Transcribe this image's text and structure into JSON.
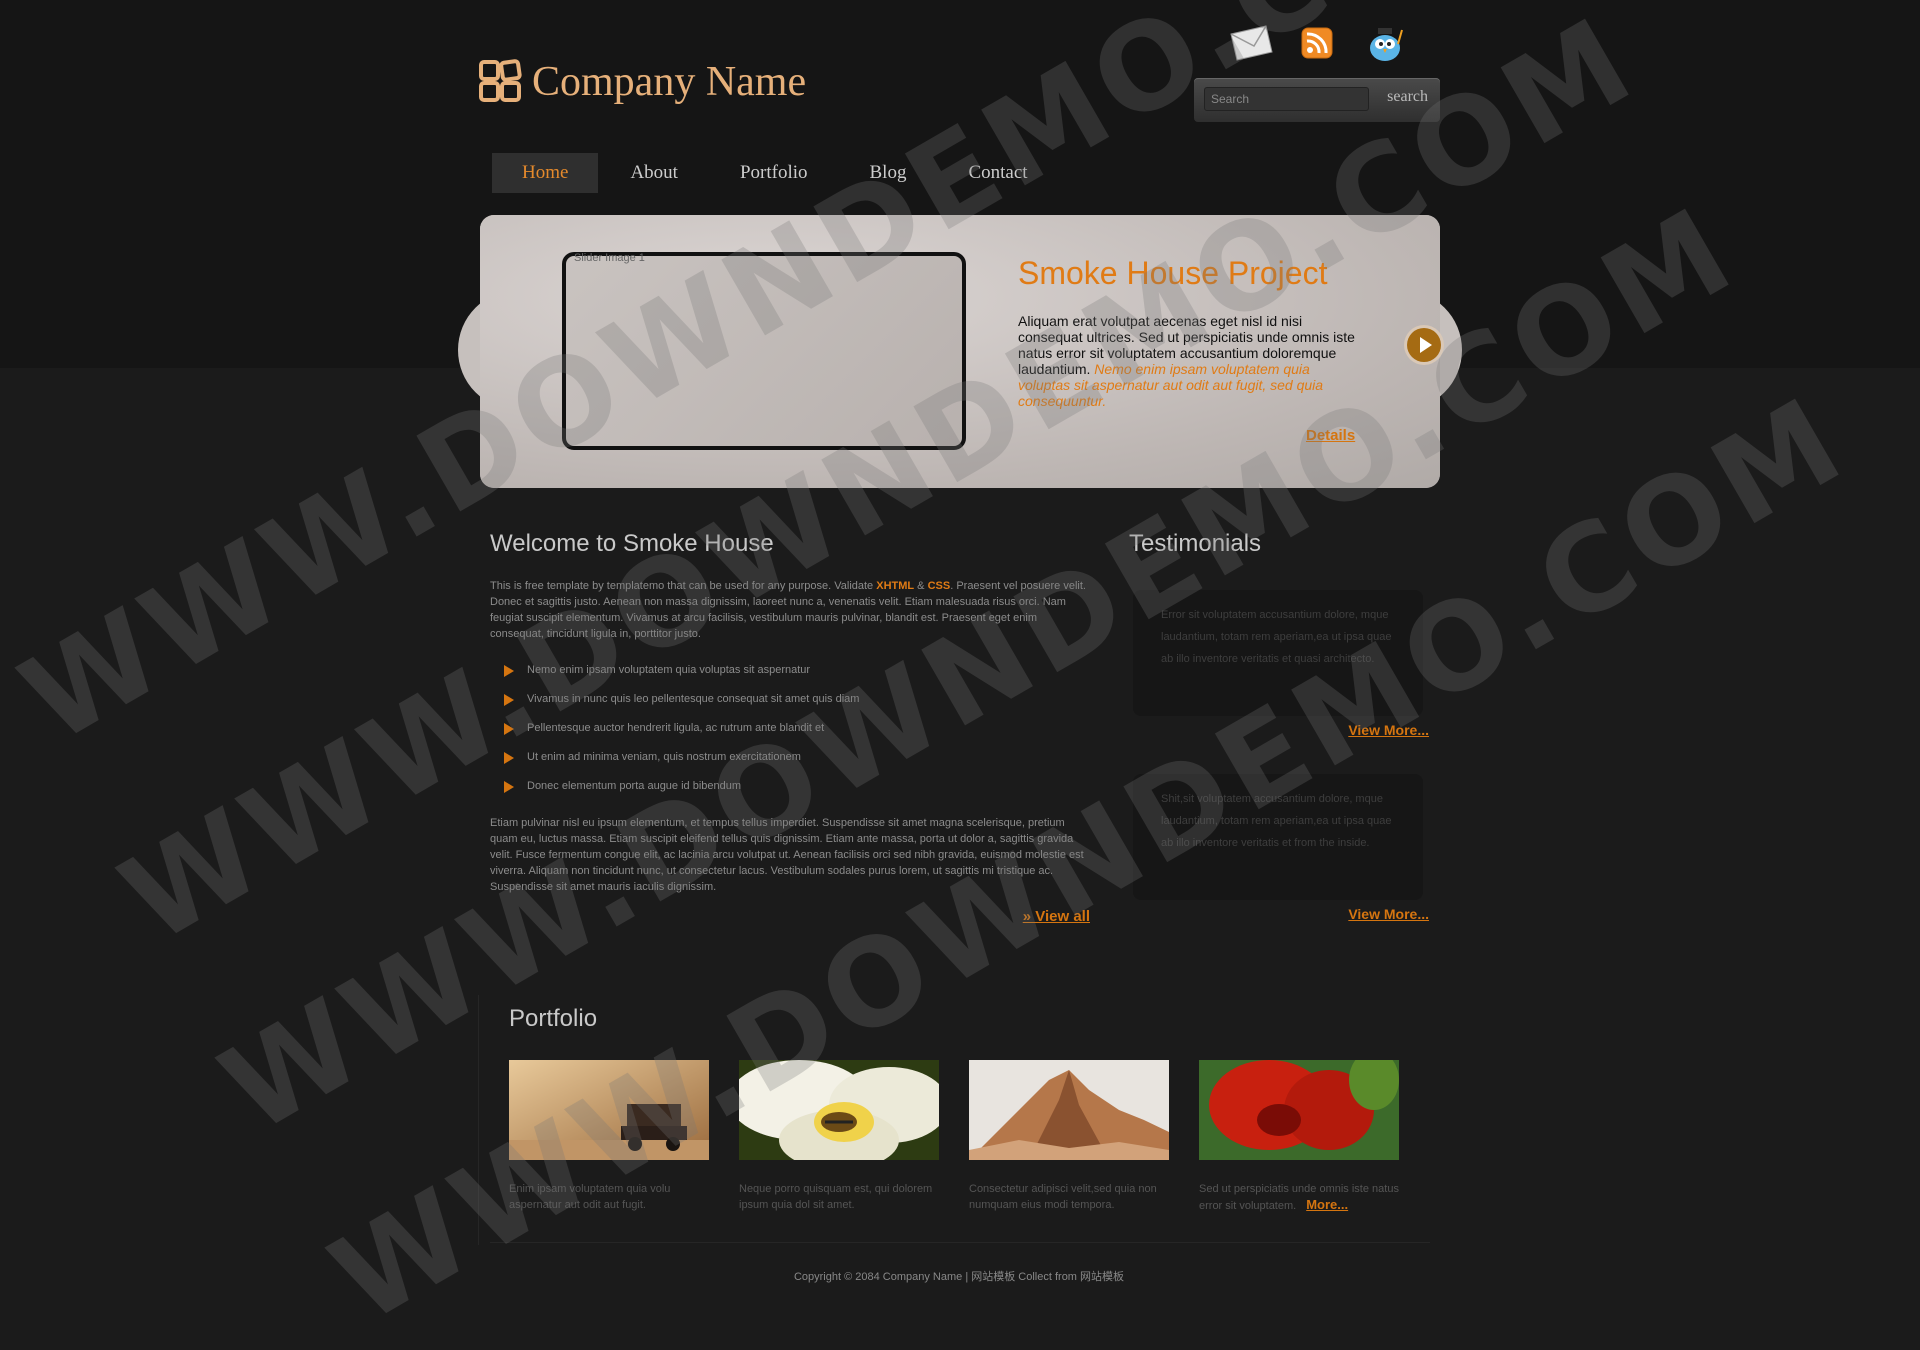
{
  "header": {
    "company_name": "Company Name",
    "social_icons": [
      "mail-icon",
      "rss-icon",
      "twitter-bird-icon"
    ],
    "search": {
      "placeholder": "Search",
      "button_label": "search"
    }
  },
  "nav": {
    "items": [
      {
        "label": "Home",
        "active": true
      },
      {
        "label": "About",
        "active": false
      },
      {
        "label": "Portfolio",
        "active": false
      },
      {
        "label": "Blog",
        "active": false
      },
      {
        "label": "Contact",
        "active": false
      }
    ]
  },
  "slider": {
    "image_alt": "Slider Image 1",
    "title": "Smoke House Project",
    "description": "Aliquam erat volutpat aecenas eget nisl id nisi consequat ultrices. Sed ut perspiciatis unde omnis iste natus error sit voluptatem accusantium doloremque laudantium.",
    "description_em": "Nemo enim ipsam voluptatem quia voluptas sit aspernatur aut odit aut fugit, sed quia consequuntur.",
    "details_label": "Details"
  },
  "welcome": {
    "title": "Welcome to Smoke House",
    "intro_1": "This is free template by templatemo that can be used for any purpose. Validate ",
    "xhtml": "XHTML",
    "amp": " & ",
    "css": "CSS",
    "intro_2": ". Praesent vel posuere velit. Donec et sagittis justo. Aenean non massa dignissim, laoreet nunc a, venenatis velit. Etiam malesuada risus orci. Nam feugiat suscipit elementum. Vivamus at arcu facilisis, vestibulum mauris pulvinar, blandit est. Praesent eget enim consequat, tincidunt ligula in, porttitor justo.",
    "bullets": [
      "Nemo enim ipsam voluptatem quia voluptas sit aspernatur",
      "Vivamus in nunc quis leo pellentesque consequat sit amet quis diam",
      "Pellentesque auctor hendrerit ligula, ac rutrum ante blandit et",
      "Ut enim ad minima veniam, quis nostrum exercitationem",
      "Donec elementum porta augue id bibendum"
    ],
    "outro": "Etiam pulvinar nisl eu ipsum elementum, et tempus tellus imperdiet. Suspendisse sit amet magna scelerisque, pretium quam eu, luctus massa. Etiam suscipit eleifend tellus quis dignissim. Etiam ante massa, porta ut dolor a, sagittis gravida velit. Fusce fermentum congue elit, ac lacinia arcu volutpat ut. Aenean facilisis orci sed nibh gravida, euismod molestie est viverra. Aliquam non tincidunt nunc, ut consectetur lacus. Vestibulum sodales purus lorem, ut sagittis mi tristique ac. Suspendisse sit amet mauris iaculis dignissim.",
    "view_all": "» View all"
  },
  "testimonials": {
    "title": "Testimonials",
    "items": [
      {
        "text": "Error sit voluptatem accusantium dolore, mque laudantium, totam rem aperiam,ea ut ipsa quae ab illo inventore veritatis et quasi architecto.",
        "more": "View More..."
      },
      {
        "text": "Shit,sit voluptatem accusantium dolore, mque laudantium, totam rem aperiam,ea ut ipsa quae ab illo inventore veritatis et from the inside.",
        "more": "View More..."
      }
    ]
  },
  "portfolio": {
    "title": "Portfolio",
    "items": [
      {
        "image": "truck-desert-image",
        "caption": "Enim ipsam voluptatem quia volu aspernatur aut odit aut fugit."
      },
      {
        "image": "bee-flower-image",
        "caption": "Neque porro quisquam est, qui dolorem ipsum quia dol sit amet."
      },
      {
        "image": "mountain-image",
        "caption": "Consectetur adipisci velit,sed quia non numquam eius modi tempora."
      },
      {
        "image": "red-flower-image",
        "caption": "Sed ut perspiciatis unde omnis iste natus error sit voluptatem."
      }
    ],
    "more_label": "More..."
  },
  "footer": {
    "copyright": "Copyright © 2084 Company Name | 网站模板 Collect from 网站模板"
  },
  "watermark": "WWW.DOWNDEMO.COM",
  "colors": {
    "accent": "#e07b15",
    "logo": "#e6b07a",
    "background": "#1b1b1b"
  }
}
